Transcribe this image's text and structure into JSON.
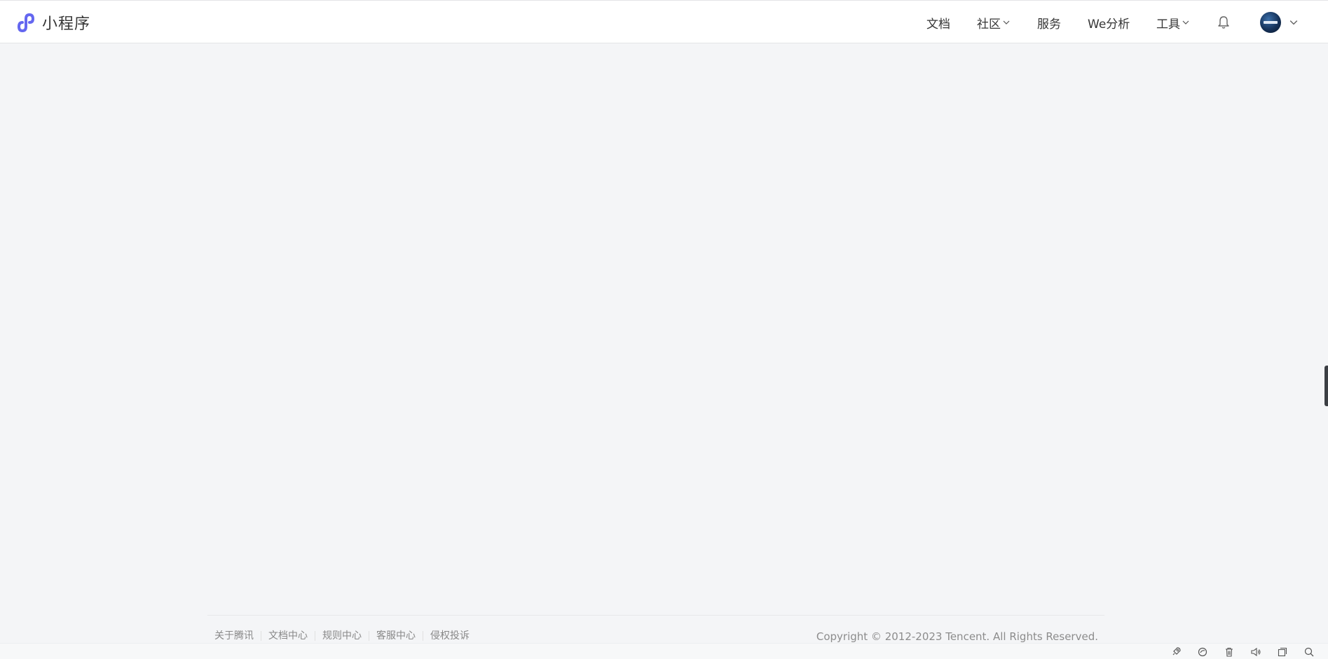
{
  "brand": {
    "name": "小程序",
    "accent_color": "#6467f0"
  },
  "nav": {
    "docs": "文档",
    "community": "社区",
    "services": "服务",
    "analytics": "We分析",
    "tools": "工具",
    "notifications_icon": "bell-icon",
    "user_menu_icon": "chevron-down-icon"
  },
  "footer": {
    "links": [
      "关于腾讯",
      "文档中心",
      "规则中心",
      "客服中心",
      "侵权投诉"
    ],
    "copyright": "Copyright © 2012-2023 Tencent. All Rights Reserved."
  },
  "tray": {
    "icons": [
      "rocket-icon",
      "refresh-icon",
      "trash-icon",
      "speaker-icon",
      "window-icon",
      "search-icon"
    ]
  }
}
